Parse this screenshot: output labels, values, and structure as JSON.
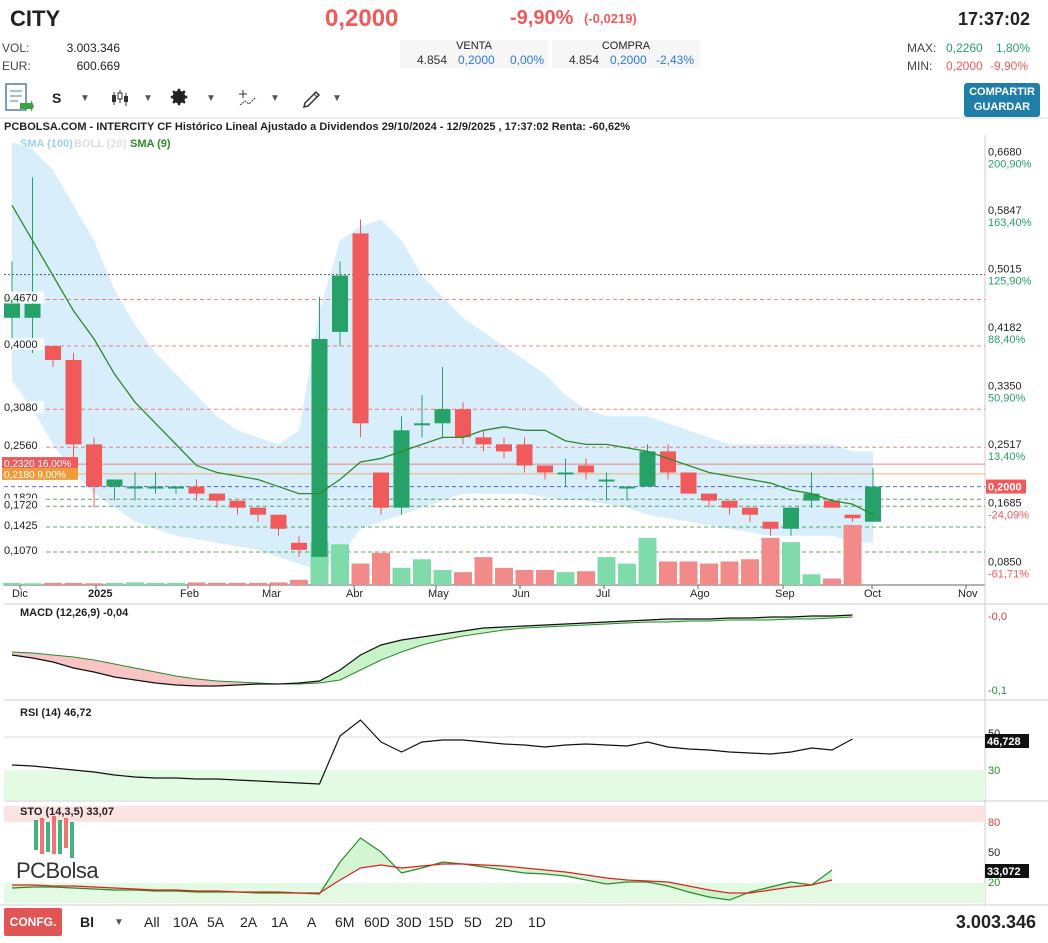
{
  "header": {
    "ticker": "CITY",
    "price": "0,2000",
    "change_pct": "-9,90%",
    "change_abs": "(-0,0219)",
    "time": "17:37:02",
    "vol_label": "VOL:",
    "vol_value": "3.003.346",
    "eur_label": "EUR:",
    "eur_value": "600.669",
    "venta_label": "VENTA",
    "venta_qty": "4.854",
    "venta_price": "0,2000",
    "venta_pct": "0,00%",
    "compra_label": "COMPRA",
    "compra_qty": "4.854",
    "compra_price": "0,2000",
    "compra_pct": "-2,43%",
    "max_label": "MAX:",
    "max_value": "0,2260",
    "max_pct": "1,80%",
    "min_label": "MIN:",
    "min_value": "0,2000",
    "min_pct": "-9,90%"
  },
  "toolbar": {
    "scale_label": "S",
    "share_label": "COMPARTIR",
    "save_label": "GUARDAR",
    "icons": [
      "document-export-icon",
      "candlestick-icon",
      "gear-icon",
      "drawing-tools-icon",
      "pencil-icon"
    ]
  },
  "chart_title": "PCBOLSA.COM - INTERCITY CF Histórico Lineal Ajustado a Dividendos 29/10/2024 - 12/9/2025 , 17:37:02 Renta: -60,62%",
  "legend": {
    "sma100": "SMA (100)",
    "boll": "BOLL (20)",
    "sma9": "SMA (9)"
  },
  "colors": {
    "up": "#26a269",
    "down": "#f05a5a",
    "band": "#d9eefb",
    "sma9": "#2c8a2c"
  },
  "chart_data": {
    "type": "candlestick",
    "x_labels": [
      "Dic",
      "2025",
      "Feb",
      "Mar",
      "Abr",
      "May",
      "Jun",
      "Jul",
      "Ago",
      "Sep",
      "Oct",
      "Nov"
    ],
    "right_axis": [
      {
        "price": "0,6680",
        "pct": "200,90%"
      },
      {
        "price": "0,5847",
        "pct": "163,40%"
      },
      {
        "price": "0,5015",
        "pct": "125,90%"
      },
      {
        "price": "0,4182",
        "pct": "88,40%"
      },
      {
        "price": "0,3350",
        "pct": "50,90%"
      },
      {
        "price": "0,2517",
        "pct": "13,40%"
      },
      {
        "price": "0,2000",
        "pct": ""
      },
      {
        "price": "0,1685",
        "pct": "-24,09%"
      },
      {
        "price": "0,0850",
        "pct": "-61,71%"
      }
    ],
    "left_levels": [
      "0,4670",
      "0,4000",
      "0,3080",
      "0,2560",
      "0,1820",
      "0,1720",
      "0,1425",
      "0,1070"
    ],
    "tag_red": "0,2320  16,00%",
    "tag_orange": "0,2180  9,00%",
    "ylim": [
      0.06,
      0.7
    ],
    "candles": [
      {
        "o": 0.44,
        "h": 0.52,
        "l": 0.41,
        "c": 0.47
      },
      {
        "o": 0.44,
        "h": 0.64,
        "l": 0.39,
        "c": 0.46
      },
      {
        "o": 0.4,
        "h": 0.4,
        "l": 0.37,
        "c": 0.38
      },
      {
        "o": 0.38,
        "h": 0.39,
        "l": 0.24,
        "c": 0.26
      },
      {
        "o": 0.26,
        "h": 0.27,
        "l": 0.17,
        "c": 0.2
      },
      {
        "o": 0.2,
        "h": 0.21,
        "l": 0.18,
        "c": 0.21
      },
      {
        "o": 0.2,
        "h": 0.22,
        "l": 0.18,
        "c": 0.2
      },
      {
        "o": 0.2,
        "h": 0.22,
        "l": 0.19,
        "c": 0.2
      },
      {
        "o": 0.2,
        "h": 0.2,
        "l": 0.19,
        "c": 0.2
      },
      {
        "o": 0.2,
        "h": 0.21,
        "l": 0.18,
        "c": 0.19
      },
      {
        "o": 0.19,
        "h": 0.19,
        "l": 0.17,
        "c": 0.18
      },
      {
        "o": 0.18,
        "h": 0.18,
        "l": 0.16,
        "c": 0.17
      },
      {
        "o": 0.17,
        "h": 0.17,
        "l": 0.15,
        "c": 0.16
      },
      {
        "o": 0.16,
        "h": 0.16,
        "l": 0.13,
        "c": 0.14
      },
      {
        "o": 0.12,
        "h": 0.13,
        "l": 0.1,
        "c": 0.11
      },
      {
        "o": 0.1,
        "h": 0.47,
        "l": 0.1,
        "c": 0.41
      },
      {
        "o": 0.42,
        "h": 0.52,
        "l": 0.4,
        "c": 0.5
      },
      {
        "o": 0.56,
        "h": 0.58,
        "l": 0.27,
        "c": 0.29
      },
      {
        "o": 0.22,
        "h": 0.22,
        "l": 0.16,
        "c": 0.17
      },
      {
        "o": 0.17,
        "h": 0.3,
        "l": 0.16,
        "c": 0.28
      },
      {
        "o": 0.29,
        "h": 0.33,
        "l": 0.27,
        "c": 0.29
      },
      {
        "o": 0.29,
        "h": 0.37,
        "l": 0.27,
        "c": 0.31
      },
      {
        "o": 0.31,
        "h": 0.32,
        "l": 0.26,
        "c": 0.27
      },
      {
        "o": 0.27,
        "h": 0.28,
        "l": 0.25,
        "c": 0.26
      },
      {
        "o": 0.26,
        "h": 0.27,
        "l": 0.24,
        "c": 0.25
      },
      {
        "o": 0.26,
        "h": 0.27,
        "l": 0.22,
        "c": 0.23
      },
      {
        "o": 0.23,
        "h": 0.23,
        "l": 0.21,
        "c": 0.22
      },
      {
        "o": 0.22,
        "h": 0.24,
        "l": 0.2,
        "c": 0.22
      },
      {
        "o": 0.23,
        "h": 0.24,
        "l": 0.21,
        "c": 0.22
      },
      {
        "o": 0.21,
        "h": 0.22,
        "l": 0.18,
        "c": 0.21
      },
      {
        "o": 0.2,
        "h": 0.2,
        "l": 0.18,
        "c": 0.2
      },
      {
        "o": 0.2,
        "h": 0.26,
        "l": 0.2,
        "c": 0.25
      },
      {
        "o": 0.25,
        "h": 0.26,
        "l": 0.21,
        "c": 0.22
      },
      {
        "o": 0.22,
        "h": 0.22,
        "l": 0.19,
        "c": 0.19
      },
      {
        "o": 0.19,
        "h": 0.19,
        "l": 0.17,
        "c": 0.18
      },
      {
        "o": 0.18,
        "h": 0.18,
        "l": 0.16,
        "c": 0.17
      },
      {
        "o": 0.17,
        "h": 0.17,
        "l": 0.15,
        "c": 0.16
      },
      {
        "o": 0.15,
        "h": 0.15,
        "l": 0.13,
        "c": 0.14
      },
      {
        "o": 0.14,
        "h": 0.17,
        "l": 0.13,
        "c": 0.17
      },
      {
        "o": 0.18,
        "h": 0.22,
        "l": 0.17,
        "c": 0.19
      },
      {
        "o": 0.18,
        "h": 0.18,
        "l": 0.17,
        "c": 0.17
      },
      {
        "o": 0.16,
        "h": 0.16,
        "l": 0.15,
        "c": 0.155
      },
      {
        "o": 0.15,
        "h": 0.226,
        "l": 0.15,
        "c": 0.2
      }
    ],
    "volumes": [
      0.5,
      0.4,
      0.5,
      0.5,
      0.4,
      0.5,
      0.6,
      0.5,
      0.5,
      0.6,
      0.5,
      0.5,
      0.5,
      0.6,
      1.2,
      10.0,
      9.5,
      5.0,
      7.5,
      4.0,
      6.0,
      3.5,
      3.0,
      6.5,
      4.0,
      3.5,
      3.5,
      3.0,
      3.2,
      6.5,
      5.0,
      11.0,
      5.5,
      5.5,
      5.0,
      5.5,
      6.0,
      11.0,
      10.0,
      2.5,
      1.5,
      14.0
    ],
    "sma9": [
      0.6,
      0.55,
      0.5,
      0.45,
      0.41,
      0.36,
      0.32,
      0.29,
      0.26,
      0.23,
      0.22,
      0.215,
      0.21,
      0.2,
      0.19,
      0.19,
      0.21,
      0.235,
      0.24,
      0.25,
      0.26,
      0.27,
      0.27,
      0.28,
      0.285,
      0.28,
      0.28,
      0.265,
      0.26,
      0.26,
      0.255,
      0.25,
      0.24,
      0.23,
      0.22,
      0.215,
      0.21,
      0.205,
      0.195,
      0.19,
      0.18,
      0.175,
      0.16
    ],
    "band_upper": [
      0.69,
      0.68,
      0.65,
      0.6,
      0.55,
      0.48,
      0.43,
      0.39,
      0.36,
      0.33,
      0.3,
      0.28,
      0.27,
      0.26,
      0.28,
      0.45,
      0.55,
      0.57,
      0.58,
      0.55,
      0.5,
      0.47,
      0.44,
      0.42,
      0.4,
      0.38,
      0.36,
      0.33,
      0.31,
      0.3,
      0.3,
      0.3,
      0.29,
      0.28,
      0.27,
      0.26,
      0.26,
      0.26,
      0.26,
      0.26,
      0.26,
      0.25,
      0.25
    ],
    "band_lower": [
      0.35,
      0.31,
      0.26,
      0.22,
      0.19,
      0.17,
      0.15,
      0.14,
      0.13,
      0.125,
      0.12,
      0.115,
      0.11,
      0.1,
      0.09,
      0.08,
      0.1,
      0.14,
      0.15,
      0.16,
      0.17,
      0.18,
      0.19,
      0.19,
      0.19,
      0.19,
      0.185,
      0.18,
      0.18,
      0.175,
      0.17,
      0.16,
      0.155,
      0.15,
      0.145,
      0.14,
      0.135,
      0.13,
      0.13,
      0.13,
      0.13,
      0.12,
      0.12
    ],
    "macd_label": "MACD (12,26,9)",
    "macd_value": "-0,04",
    "macd_axis": [
      "-0,0",
      "-0,1"
    ],
    "rsi_label": "RSI (14)",
    "rsi_value": "46,72",
    "rsi_tag": "46,728",
    "rsi_axis": [
      "50",
      "30"
    ],
    "sto_label": "STO (14,3,5)",
    "sto_value": "33,07",
    "sto_tag": "33,072",
    "sto_axis": [
      "80",
      "50",
      "20"
    ]
  },
  "bottom_bar": {
    "config_label": "CONFG.",
    "bi_label": "Bl",
    "ranges": [
      "All",
      "10A",
      "5A",
      "2A",
      "1A",
      "A",
      "6M",
      "60D",
      "30D",
      "15D",
      "5D",
      "2D",
      "1D"
    ],
    "volume_total": "3.003.346"
  },
  "logo": "PCBolsa"
}
